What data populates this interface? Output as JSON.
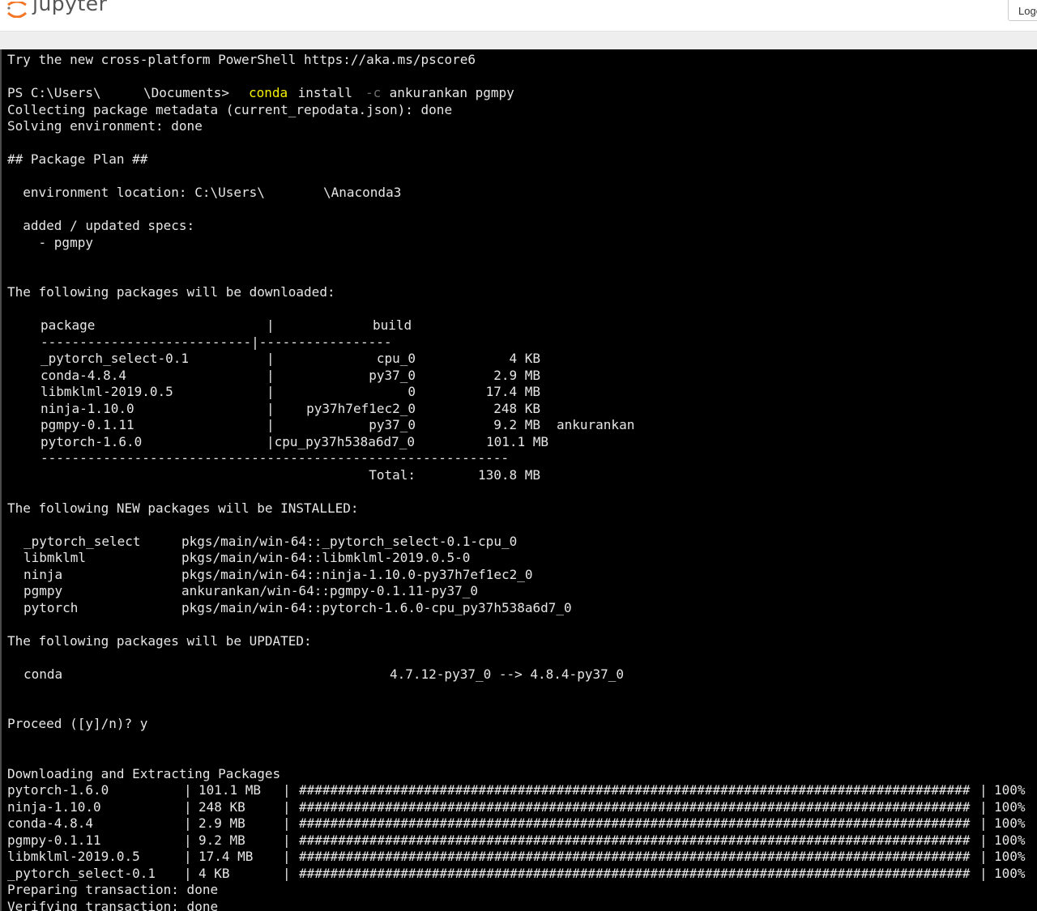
{
  "header": {
    "app_name": "jupyter",
    "logout_label": "Logout",
    "logo_icon": "jupyter-logo-icon"
  },
  "terminal": {
    "intro": "Try the new cross-platform PowerShell https://aka.ms/pscore6",
    "prompt_prefix": "PS C:\\Users\\",
    "prompt_suffix": "\\Documents> ",
    "cmd_name": "conda",
    "cmd_mid": " install ",
    "cmd_flag": "-c",
    "cmd_args": " ankurankan pgmpy",
    "collecting": "Collecting package metadata (current_repodata.json): done",
    "solving": "Solving environment: done",
    "plan_title": "## Package Plan ##",
    "env_prefix": "  environment location: C:\\Users\\",
    "env_suffix": "\\Anaconda3",
    "specs_label": "  added / updated specs:",
    "specs_item": "    - pgmpy",
    "download_title": "The following packages will be downloaded:",
    "table": {
      "col_package": "package",
      "col_sep": "|",
      "col_build": "build",
      "sep_line": "---------------------------|-----------------",
      "rows": [
        {
          "package": "_pytorch_select-0.1",
          "sep": "|",
          "build": "cpu_0",
          "size": "4 KB",
          "channel": ""
        },
        {
          "package": "conda-4.8.4",
          "sep": "|",
          "build": "py37_0",
          "size": "2.9 MB",
          "channel": ""
        },
        {
          "package": "libmklml-2019.0.5",
          "sep": "|",
          "build": "0",
          "size": "17.4 MB",
          "channel": ""
        },
        {
          "package": "ninja-1.10.0",
          "sep": "|",
          "build": "py37h7ef1ec2_0",
          "size": "248 KB",
          "channel": ""
        },
        {
          "package": "pgmpy-0.1.11",
          "sep": "|",
          "build": "py37_0",
          "size": "9.2 MB",
          "channel": "ankurankan"
        },
        {
          "package": "pytorch-1.6.0",
          "sep": "|cpu_py37h538a6d7_0",
          "build": "",
          "size": "101.1 MB",
          "channel": ""
        }
      ],
      "total_sep": "------------------------------------------------------------",
      "total_label": "Total:",
      "total_value": "130.8 MB"
    },
    "installed_title": "The following NEW packages will be INSTALLED:",
    "installed": [
      {
        "name": "_pytorch_select",
        "spec": "pkgs/main/win-64::_pytorch_select-0.1-cpu_0"
      },
      {
        "name": "libmklml",
        "spec": "pkgs/main/win-64::libmklml-2019.0.5-0"
      },
      {
        "name": "ninja",
        "spec": "pkgs/main/win-64::ninja-1.10.0-py37h7ef1ec2_0"
      },
      {
        "name": "pgmpy",
        "spec": "ankurankan/win-64::pgmpy-0.1.11-py37_0"
      },
      {
        "name": "pytorch",
        "spec": "pkgs/main/win-64::pytorch-1.6.0-cpu_py37h538a6d7_0"
      }
    ],
    "updated_title": "The following packages will be UPDATED:",
    "updated": [
      {
        "name": "conda",
        "spec": "4.7.12-py37_0 --> 4.8.4-py37_0"
      }
    ],
    "proceed": "Proceed ([y]/n)? y",
    "dl_title": "Downloading and Extracting Packages",
    "downloads": [
      {
        "name": "pytorch-1.6.0",
        "size": "101.1 MB",
        "progress": 100,
        "pct": "100%"
      },
      {
        "name": "ninja-1.10.0",
        "size": "248 KB",
        "progress": 100,
        "pct": "100%"
      },
      {
        "name": "conda-4.8.4",
        "size": "2.9 MB",
        "progress": 100,
        "pct": "100%"
      },
      {
        "name": "pgmpy-0.1.11",
        "size": "9.2 MB",
        "progress": 100,
        "pct": "100%"
      },
      {
        "name": "libmklml-2019.0.5",
        "size": "17.4 MB",
        "progress": 100,
        "pct": "100%"
      },
      {
        "name": "_pytorch_select-0.1",
        "size": "4 KB",
        "progress": 100,
        "pct": "100%"
      }
    ],
    "preparing": "Preparing transaction: done",
    "verifying": "Verifying transaction: done"
  },
  "colors": {
    "terminal_bg": "#000000",
    "terminal_fg": "#e6e6e6",
    "command_highlight": "#f5f000",
    "flag_dim": "#6e6e6e",
    "logo_orange": "#f37726"
  }
}
